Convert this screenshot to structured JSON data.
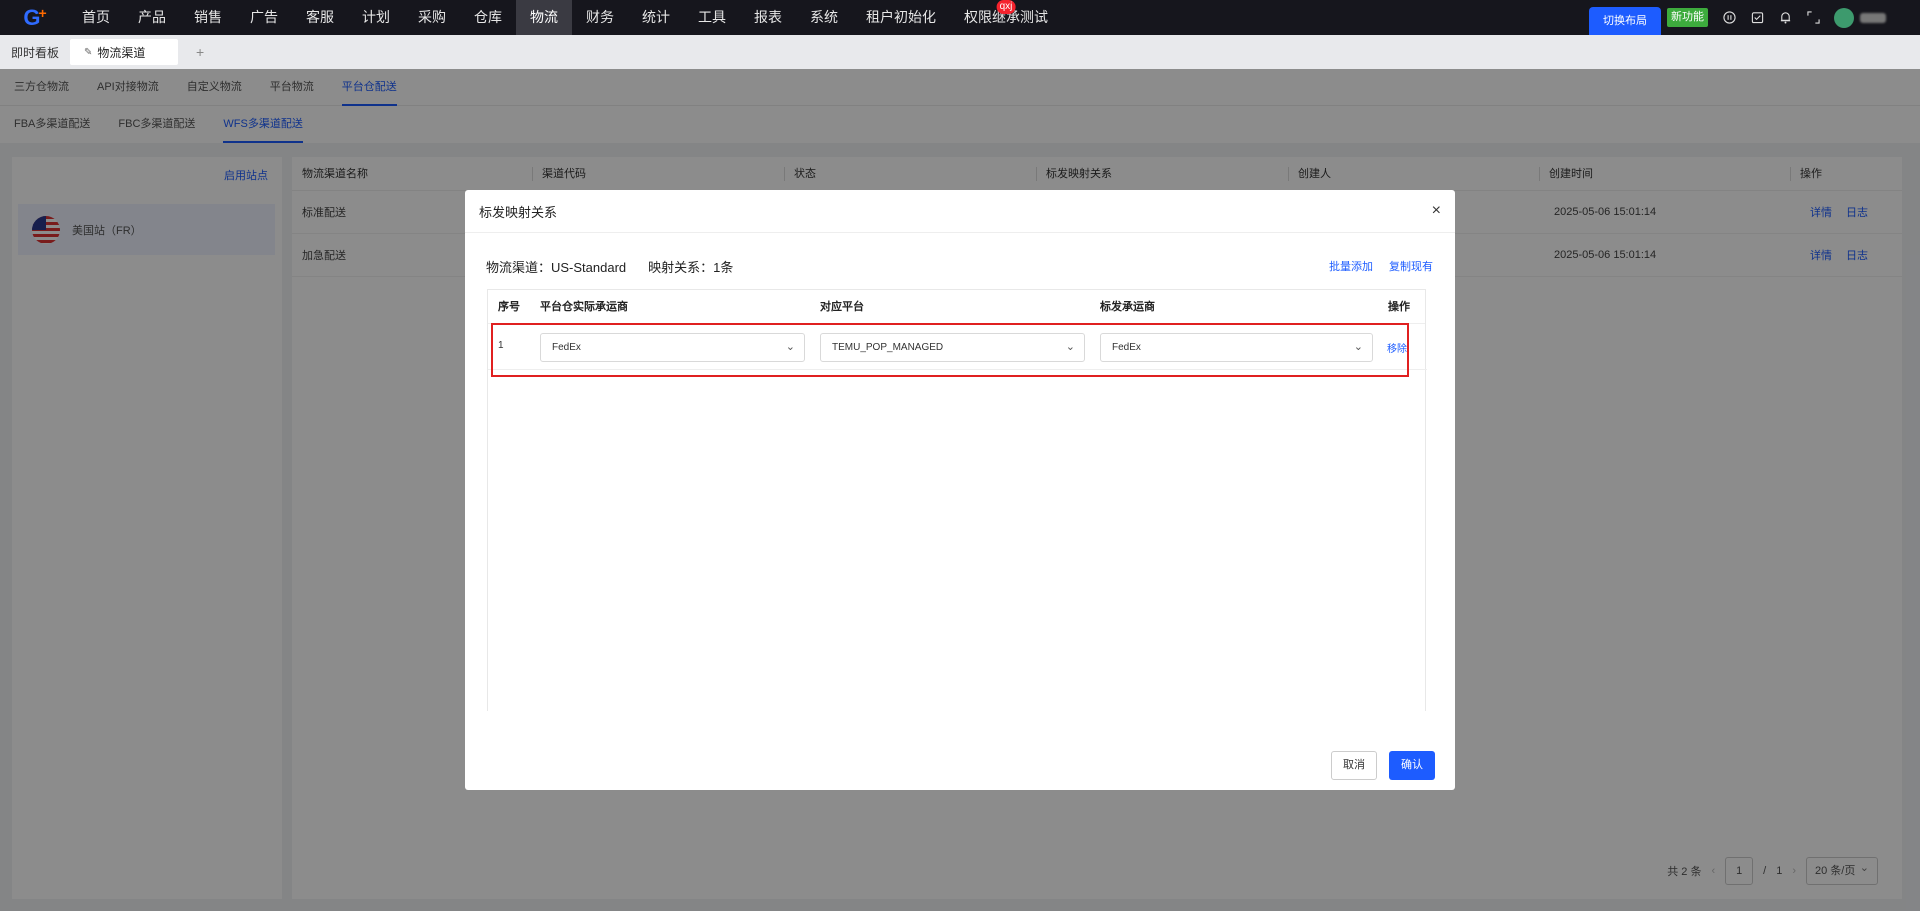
{
  "logo": {
    "text": "G",
    "plus": "+"
  },
  "nav": {
    "items": [
      "首页",
      "产品",
      "销售",
      "广告",
      "客服",
      "计划",
      "采购",
      "仓库",
      "物流",
      "财务",
      "统计",
      "工具",
      "报表",
      "系统",
      "租户初始化",
      "权限继承测试"
    ],
    "active_index": 8,
    "badge": {
      "index": 15,
      "text": "qxj"
    }
  },
  "top_right": {
    "switch_layout": "切换布局",
    "new_feature": "新功能",
    "icons": [
      "info-icon",
      "task-icon",
      "bell-icon",
      "fullscreen-icon"
    ]
  },
  "tabbar": {
    "home": "即时看板",
    "current": "物流渠道",
    "add": "+"
  },
  "subtabs": {
    "items": [
      "三方仓物流",
      "API对接物流",
      "自定义物流",
      "平台物流",
      "平台仓配送"
    ],
    "active_index": 4
  },
  "subtabs2": {
    "items": [
      "FBA多渠道配送",
      "FBC多渠道配送",
      "WFS多渠道配送"
    ],
    "active_index": 2
  },
  "left": {
    "enable_site": "启用站点",
    "site": "美国站（FR）"
  },
  "table": {
    "columns": [
      "物流渠道名称",
      "渠道代码",
      "状态",
      "标发映射关系",
      "创建人",
      "创建时间",
      "操作"
    ],
    "rows": [
      {
        "name": "标准配送",
        "time": "2025-05-06 15:01:14",
        "detail": "详情",
        "log": "日志"
      },
      {
        "name": "加急配送",
        "time": "2025-05-06 15:01:14",
        "detail": "详情",
        "log": "日志"
      }
    ]
  },
  "pagination": {
    "total": "共 2 条",
    "prev": "‹",
    "page": "1",
    "sep": "/",
    "pages": "1",
    "next": "›",
    "size": "20 条/页"
  },
  "modal": {
    "title": "标发映射关系",
    "close": "×",
    "channel_label": "物流渠道：US-Standard",
    "count_label": "映射关系：1条",
    "batch_add": "批量添加",
    "copy_existing": "复制现有",
    "columns": [
      "序号",
      "平台仓实际承运商",
      "对应平台",
      "标发承运商",
      "操作"
    ],
    "row": {
      "index": "1",
      "carrier": "FedEx",
      "platform": "TEMU_POP_MANAGED",
      "ship_carrier": "FedEx",
      "remove": "移除"
    },
    "cancel": "取消",
    "confirm": "确认"
  },
  "colors": {
    "accent": "#1d5cff",
    "nav_bg": "#16161d",
    "highlight": "#e02020",
    "new_feature": "#3dab3d"
  }
}
